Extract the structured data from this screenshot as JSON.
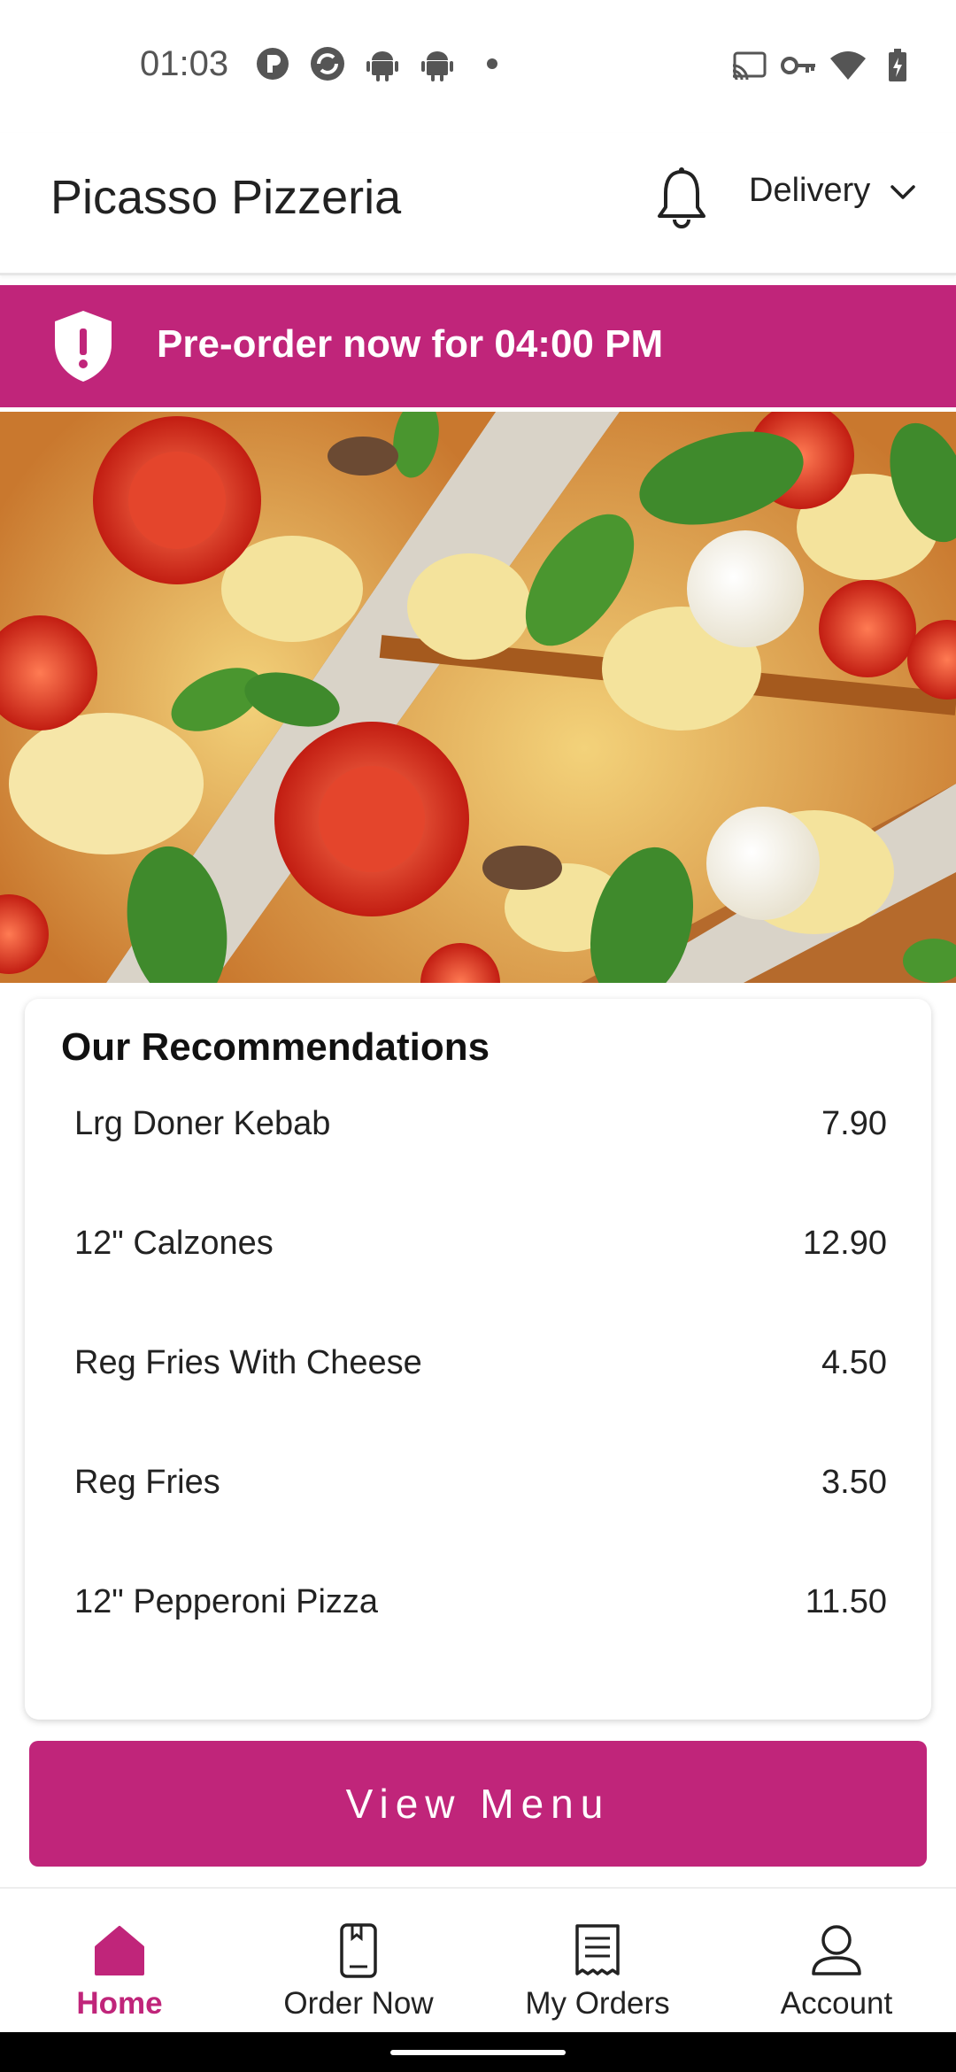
{
  "status_bar": {
    "time": "01:03",
    "left_icons": [
      "p-circle-icon",
      "sync-circle-icon",
      "android-icon",
      "android-icon",
      "dot-icon"
    ],
    "right_icons": [
      "cast-icon",
      "key-icon",
      "wifi-icon",
      "battery-charging-icon"
    ]
  },
  "header": {
    "title": "Picasso Pizzeria",
    "bell_icon": "bell-icon",
    "delivery_label": "Delivery"
  },
  "banner": {
    "text": "Pre-order now for 04:00 PM",
    "icon": "shield-alert-icon"
  },
  "recommendations": {
    "title": "Our Recommendations",
    "items": [
      {
        "name": "Lrg Doner Kebab",
        "price": "7.90"
      },
      {
        "name": "12\" Calzones",
        "price": "12.90"
      },
      {
        "name": "Reg Fries With Cheese",
        "price": "4.50"
      },
      {
        "name": "Reg Fries",
        "price": "3.50"
      },
      {
        "name": "12\" Pepperoni Pizza",
        "price": "11.50"
      }
    ]
  },
  "view_menu_label": "View Menu",
  "nav": {
    "items": [
      {
        "label": "Home",
        "icon": "home-icon",
        "active": true
      },
      {
        "label": "Order Now",
        "icon": "bookmark-phone-icon",
        "active": false
      },
      {
        "label": "My Orders",
        "icon": "receipt-icon",
        "active": false
      },
      {
        "label": "Account",
        "icon": "user-icon",
        "active": false
      }
    ]
  },
  "colors": {
    "accent": "#c0257a",
    "text": "#222222"
  }
}
